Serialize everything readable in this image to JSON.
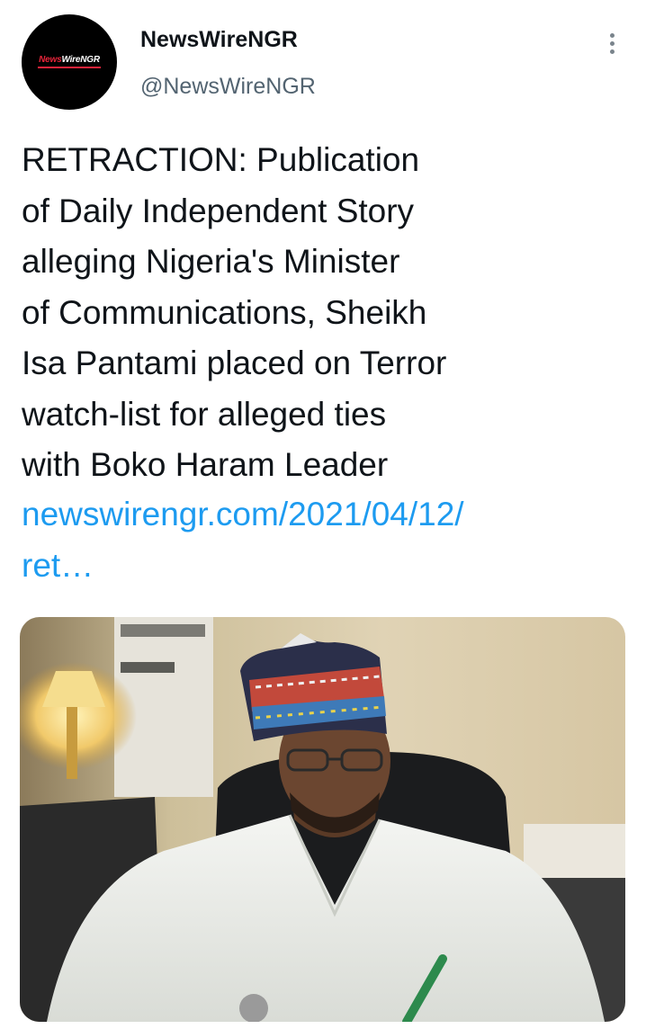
{
  "author": {
    "avatar_logo_text": "NewsWireNGR",
    "avatar_logo_prefix": "News",
    "avatar_logo_suffix": "WireNGR",
    "display_name": "NewsWireNGR",
    "handle": "@NewsWireNGR"
  },
  "tweet": {
    "text": "RETRACTION: Publication\nof Daily Independent Story\nalleging Nigeria's Minister\nof Communications, Sheikh\nIsa Pantami placed on Terror\nwatch-list for alleged ties\nwith Boko Haram Leader",
    "link": "newswirengr.com/2021/04/12/\nret…"
  },
  "media": {
    "type": "photo"
  },
  "colors": {
    "text": "#0f1419",
    "secondary": "#536471",
    "link": "#1d9bf0",
    "logo_red": "#e8243a"
  },
  "icons": {
    "more": "more-vertical-icon"
  }
}
